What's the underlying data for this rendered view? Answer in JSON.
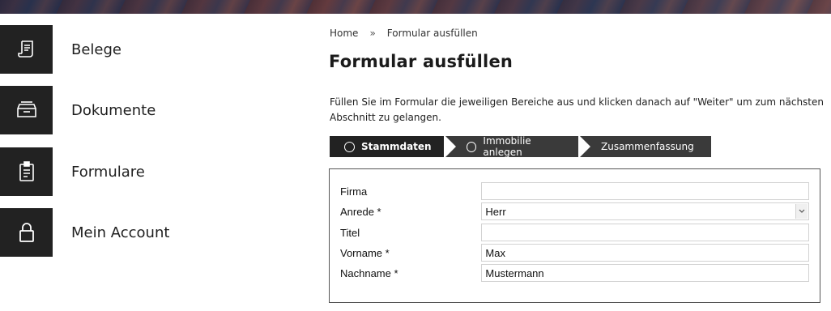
{
  "sidebar": {
    "items": [
      {
        "label": "Belege",
        "icon": "receipt-icon"
      },
      {
        "label": "Dokumente",
        "icon": "inbox-tray-icon"
      },
      {
        "label": "Formulare",
        "icon": "clipboard-icon"
      },
      {
        "label": "Mein Account",
        "icon": "lock-icon"
      }
    ]
  },
  "breadcrumb": {
    "home": "Home",
    "separator": "»",
    "current": "Formular ausfüllen"
  },
  "page": {
    "title": "Formular ausfüllen",
    "intro": "Füllen Sie im Formular die jeweiligen Bereiche aus und klicken danach auf \"Weiter\" um zum nächsten Abschnitt zu gelangen."
  },
  "steps": [
    {
      "label": "Stammdaten",
      "active": true
    },
    {
      "label": "Immobilie anlegen",
      "active": false
    },
    {
      "label": "Zusammenfassung",
      "active": false
    }
  ],
  "form": {
    "fields": [
      {
        "label": "Firma",
        "value": ""
      },
      {
        "label": "Anrede *",
        "value": "Herr"
      },
      {
        "label": "Titel",
        "value": ""
      },
      {
        "label": "Vorname *",
        "value": "Max"
      },
      {
        "label": "Nachname *",
        "value": "Mustermann"
      }
    ]
  },
  "colors": {
    "sidebar_icon_bg": "#222222",
    "step_active_bg": "#222222",
    "step_bg": "#3a3a3a"
  }
}
